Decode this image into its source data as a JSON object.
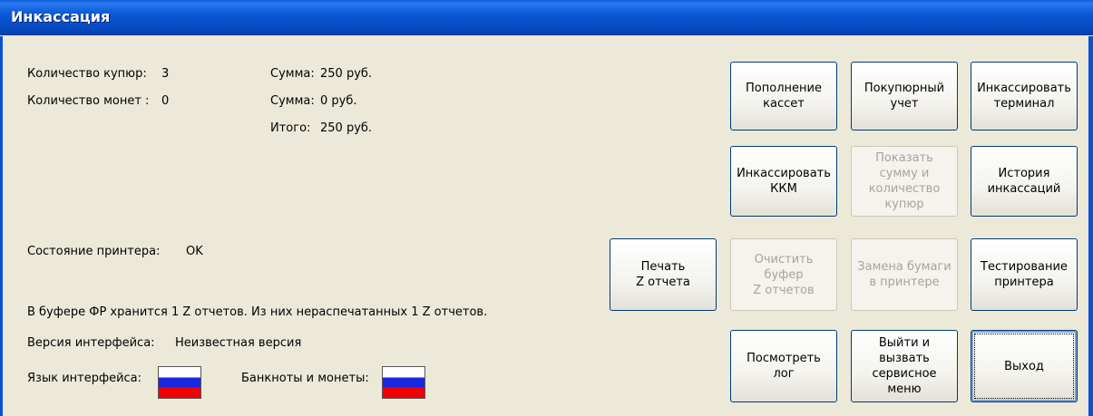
{
  "window": {
    "title": "Инкассация"
  },
  "info": {
    "bills_label": "Количество купюр:",
    "bills_value": "3",
    "coins_label": "Количество монет :",
    "coins_value": "0",
    "sum1_label": "Сумма:",
    "sum1_value": "250 руб.",
    "sum2_label": "Сумма:",
    "sum2_value": "0 руб.",
    "total_label": "Итого:",
    "total_value": "250 руб.",
    "printer_label": "Состояние принтера:",
    "printer_value": "OK",
    "buffer_text": "В буфере ФР хранится 1 Z отчетов. Из них нераспечатанных 1 Z отчетов.",
    "version_label": "Версия интерфейса:",
    "version_value": "Неизвестная версия",
    "lang_label": "Язык интерфейса:",
    "money_label": "Банкноты и монеты:",
    "flag_icon": "russia-flag-icon"
  },
  "buttons": {
    "refill": "Пополнение\nкассет",
    "by_bill": "Покупюрный\nучет",
    "collect_terminal": "Инкассировать\nтерминал",
    "collect_kkm": "Инкассировать\nККМ",
    "show_sum": "Показать\nсумму и\nколичество\nкупюр",
    "history": "История\nинкассаций",
    "print_z": "Печать\nZ отчета",
    "clear_buffer": "Очистить\nбуфер\nZ отчетов",
    "paper": "Замена бумаги\nв принтере",
    "test_printer": "Тестирование\nпринтера",
    "view_log": "Посмотреть\nлог",
    "service_menu": "Выйти и\nвызвать\nсервисное\nменю",
    "exit": "Выход"
  },
  "colors": {
    "titlebar": "#0a59d6",
    "background": "#ece9d8",
    "flag_white": "#ffffff",
    "flag_blue": "#1a28e0",
    "flag_red": "#f00000"
  }
}
